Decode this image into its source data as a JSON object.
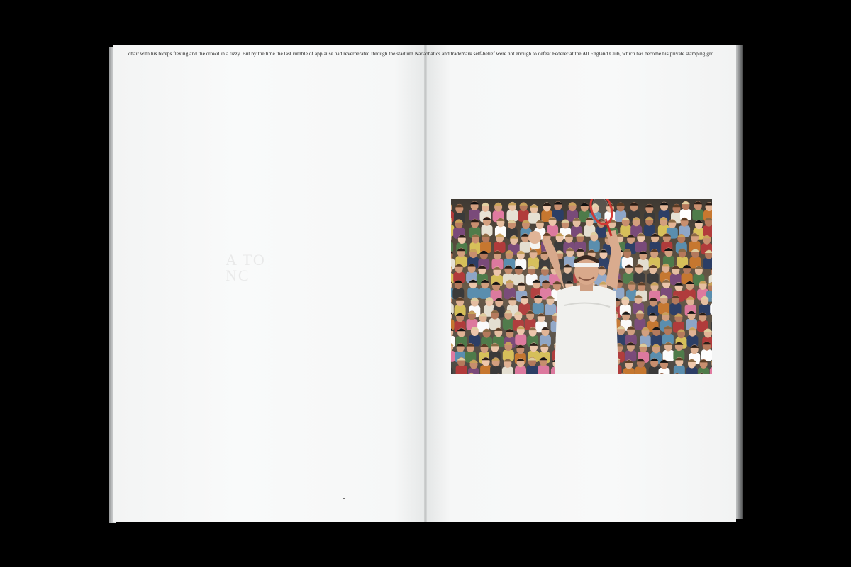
{
  "spread": {
    "left_page": {
      "text_line": "chair with his biceps flexing and the crowd in a tizzy.  But by the time the last rumble of applause had reverberated through the stadium Nadal's acr",
      "show_through_lines": [
        "A TO",
        "NC"
      ]
    },
    "right_page": {
      "text_line": "obatics and trademark self-belief were not enough to defeat Federer at the All England Club, which has become his private stamping ground.",
      "photo": {
        "subject": "tennis-player-celebrating-with-racket",
        "colors": {
          "crowd": "#6b5b4c",
          "shirt": "#f2f2f0",
          "headband": "#e8e8e6"
        }
      }
    }
  }
}
